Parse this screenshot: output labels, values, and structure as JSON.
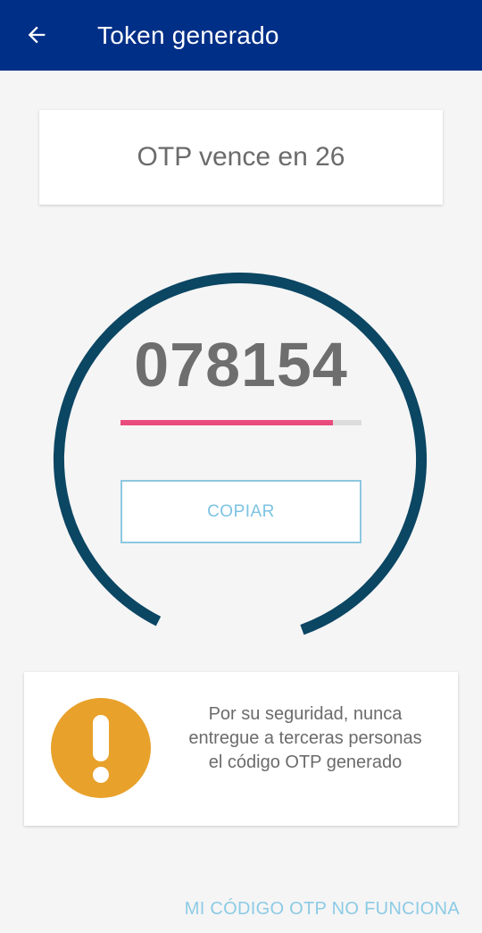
{
  "app_bar": {
    "title": "Token generado",
    "back_icon": "arrow-left-icon",
    "background_color": "#002f87"
  },
  "expiry": {
    "text": "OTP vence en 26"
  },
  "token": {
    "code": "078154",
    "timer_fraction_remaining": 0.87,
    "progress_fraction": 0.88,
    "ring_color": "#0b4663",
    "progress_color": "#e94b7d"
  },
  "copy_button": {
    "label": "COPIAR"
  },
  "security_notice": {
    "icon": "exclamation-icon",
    "icon_color": "#e8a12b",
    "lines": [
      "Por su seguridad, nunca",
      "entregue a terceras personas",
      "el código OTP generado"
    ]
  },
  "help_link": {
    "label": "MI CÓDIGO OTP NO FUNCIONA"
  }
}
